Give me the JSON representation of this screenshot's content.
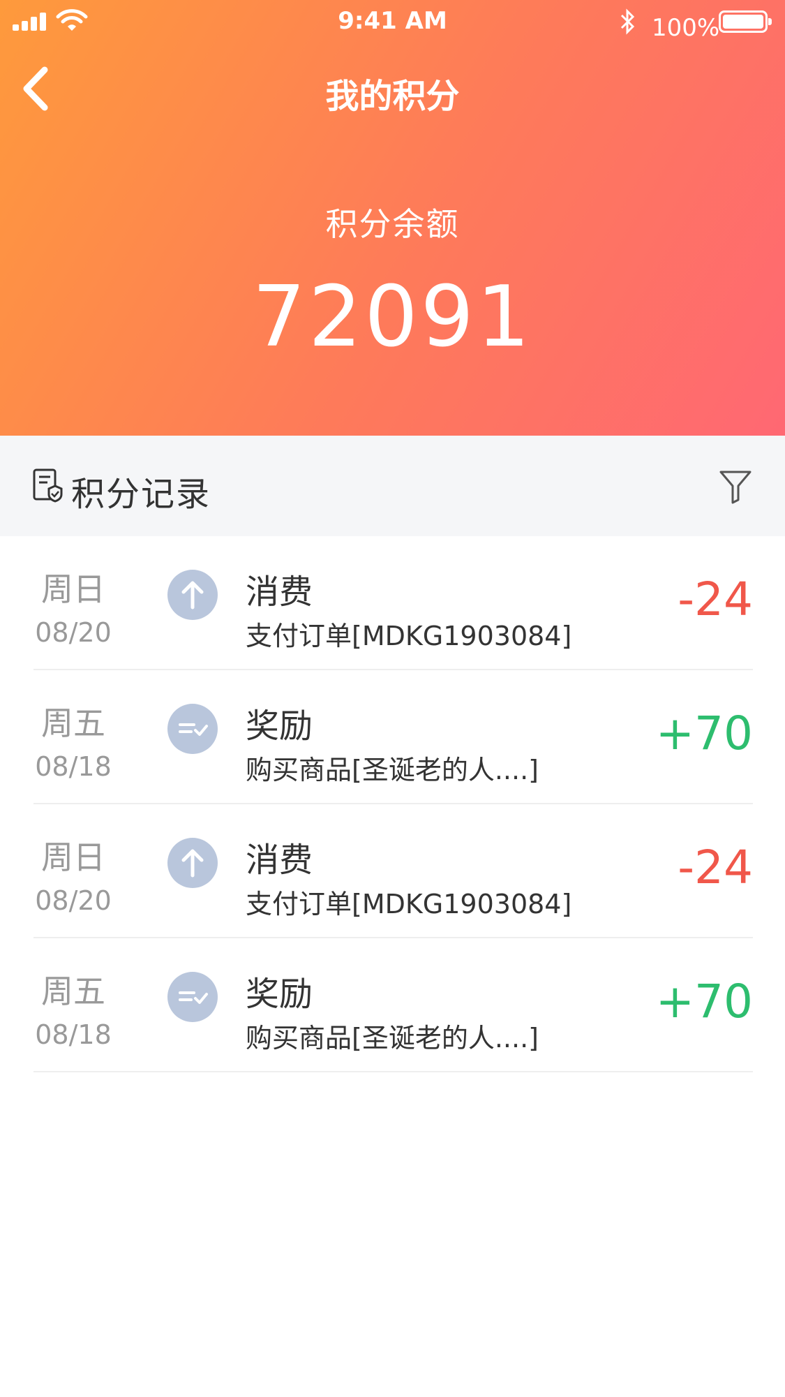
{
  "status_bar": {
    "time": "9:41 AM",
    "battery": "100%"
  },
  "nav": {
    "title": "我的积分",
    "back_icon": "chevron-left-icon"
  },
  "balance": {
    "label": "积分余额",
    "value": "72091"
  },
  "records": {
    "title": "积分记录",
    "header_icon": "records-icon",
    "filter_icon": "filter-icon",
    "items": [
      {
        "weekday": "周日",
        "date": "08/20",
        "title": "消费",
        "desc": "支付订单[MDKG1903084]",
        "amount": "-24",
        "kind": "spend",
        "icon": "arrow-up-icon"
      },
      {
        "weekday": "周五",
        "date": "08/18",
        "title": "奖励",
        "desc": "购买商品[圣诞老的人....]",
        "amount": "+70",
        "kind": "reward",
        "icon": "reward-check-icon"
      },
      {
        "weekday": "周日",
        "date": "08/20",
        "title": "消费",
        "desc": "支付订单[MDKG1903084]",
        "amount": "-24",
        "kind": "spend",
        "icon": "arrow-up-icon"
      },
      {
        "weekday": "周五",
        "date": "08/18",
        "title": "奖励",
        "desc": "购买商品[圣诞老的人....]",
        "amount": "+70",
        "kind": "reward",
        "icon": "reward-check-icon"
      }
    ]
  },
  "colors": {
    "gradient_start": "#fe9a3c",
    "gradient_end": "#ff6873",
    "negative": "#f0574a",
    "positive": "#2dbd6e",
    "icon_bg": "#b9c6dc"
  }
}
